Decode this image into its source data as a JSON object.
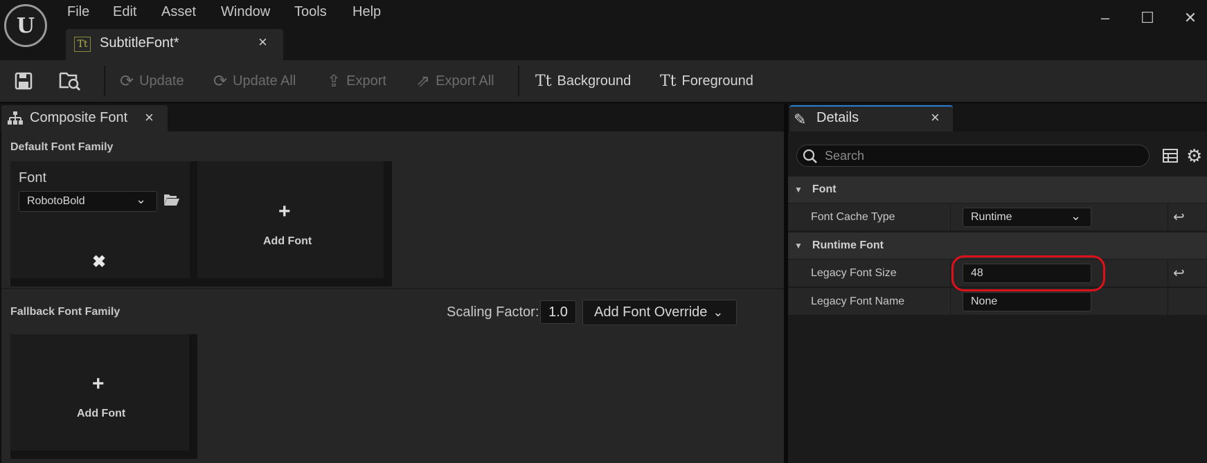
{
  "menu": [
    "File",
    "Edit",
    "Asset",
    "Window",
    "Tools",
    "Help"
  ],
  "document_tab": {
    "label": "SubtitleFont*",
    "icon": "font-asset-icon"
  },
  "window_controls": {
    "minimize": "–",
    "maximize": "☐",
    "close": "✕"
  },
  "toolbar": {
    "update": "Update",
    "update_all": "Update All",
    "export": "Export",
    "export_all": "Export All",
    "background": "Background",
    "foreground": "Foreground"
  },
  "composite_font": {
    "tab_label": "Composite Font",
    "default_family_header": "Default Font Family",
    "font_label": "Font",
    "font_value": "RobotoBold",
    "add_font": "Add Font",
    "fallback_family_header": "Fallback Font Family",
    "scaling_factor_label": "Scaling Factor:",
    "scaling_factor_value": "1.0",
    "add_font_override": "Add Font Override"
  },
  "details": {
    "tab_label": "Details",
    "search_placeholder": "Search",
    "categories": [
      {
        "label": "Font",
        "properties": [
          {
            "label": "Font Cache Type",
            "value": "Runtime"
          }
        ]
      },
      {
        "label": "Runtime Font",
        "properties": [
          {
            "label": "Legacy Font Size",
            "value": "48"
          },
          {
            "label": "Legacy Font Name",
            "value": "None"
          }
        ]
      }
    ]
  },
  "colors": {
    "highlight": "#e0101a",
    "accent": "#2a7fd4"
  }
}
